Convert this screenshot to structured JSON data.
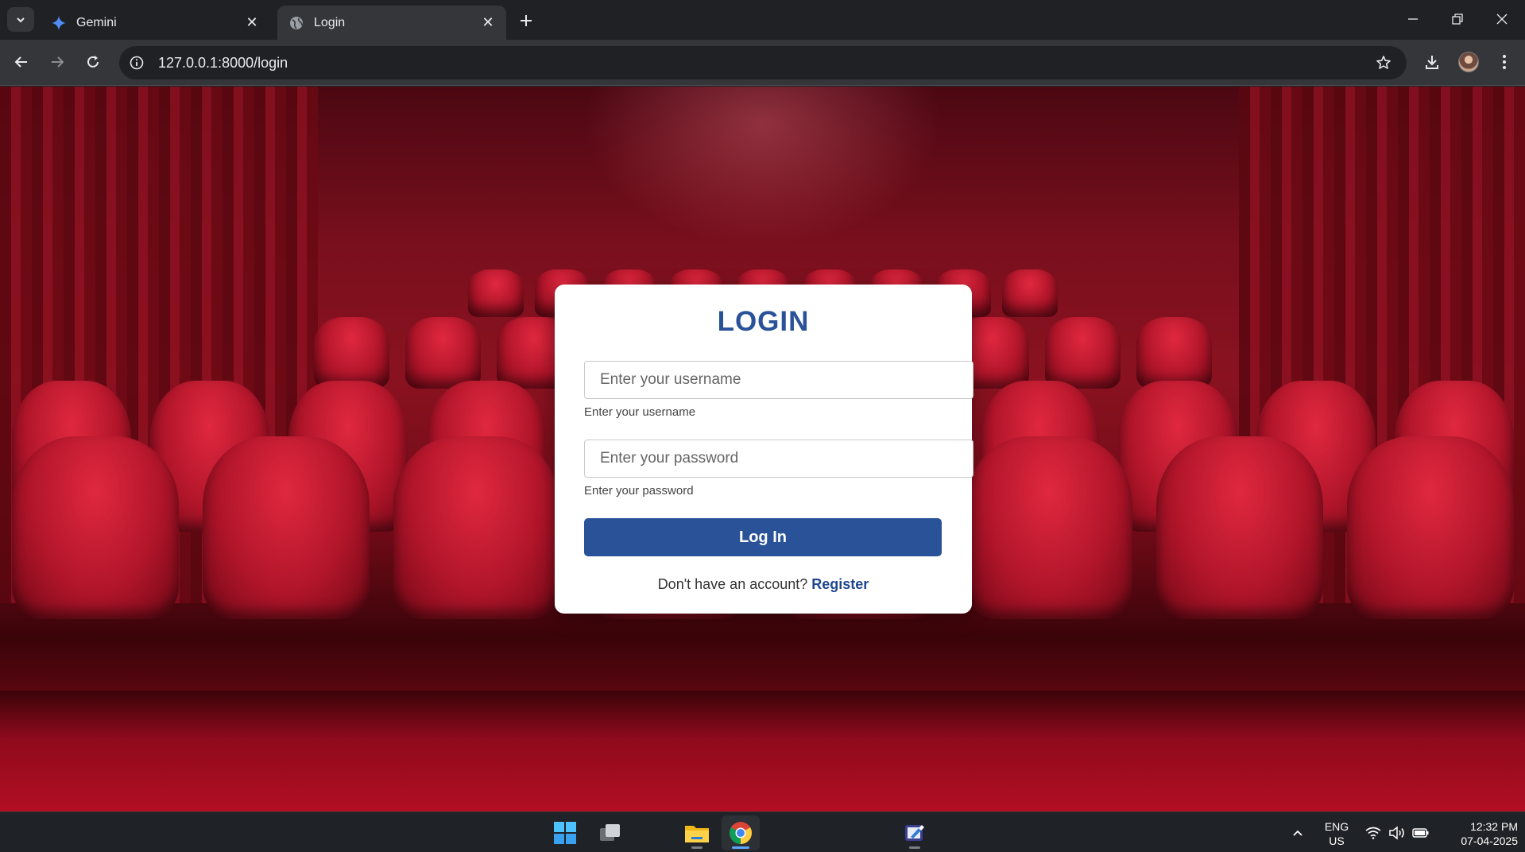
{
  "browser": {
    "tabs": [
      {
        "title": "Gemini",
        "active": false
      },
      {
        "title": "Login",
        "active": true
      }
    ],
    "url": "127.0.0.1:8000/login"
  },
  "login": {
    "heading": "LOGIN",
    "username_placeholder": "Enter your username",
    "username_helper": "Enter your username",
    "password_placeholder": "Enter your password",
    "password_helper": "Enter your password",
    "submit_label": "Log In",
    "register_prompt": "Don't have an account?",
    "register_link": "Register"
  },
  "colors": {
    "accent": "#2a5298",
    "background": "#8a1220"
  },
  "taskbar": {
    "apps": [
      "windows-start",
      "task-view",
      "file-explorer",
      "google-chrome",
      "paint-app"
    ],
    "lang_line1": "ENG",
    "lang_line2": "US",
    "time": "12:32 PM",
    "date": "07-04-2025"
  }
}
